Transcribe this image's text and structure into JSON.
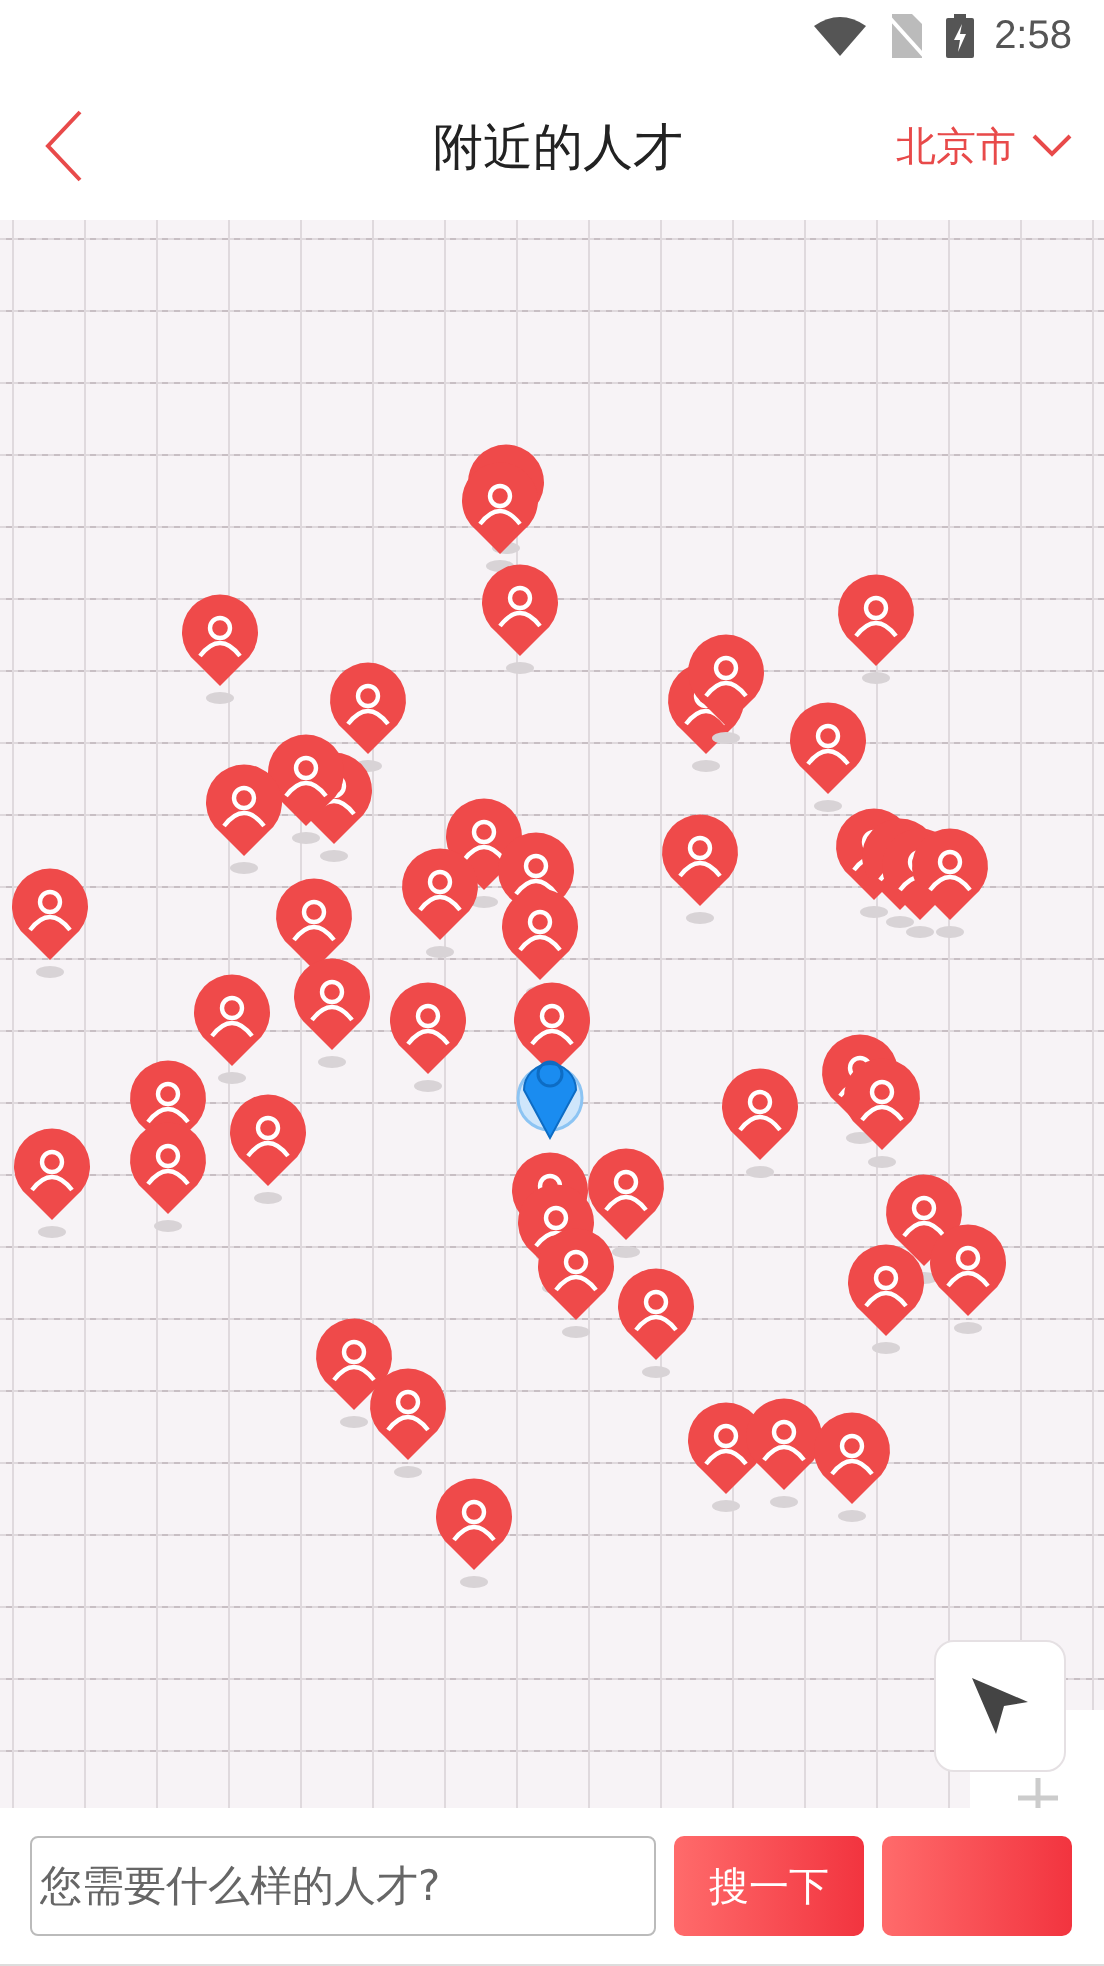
{
  "status_bar": {
    "time": "2:58"
  },
  "header": {
    "title": "附近的人才",
    "city": "北京市"
  },
  "map": {
    "kind": "grid"
  },
  "search": {
    "placeholder": "您需要什么样的人才?",
    "button": "搜一下"
  }
}
